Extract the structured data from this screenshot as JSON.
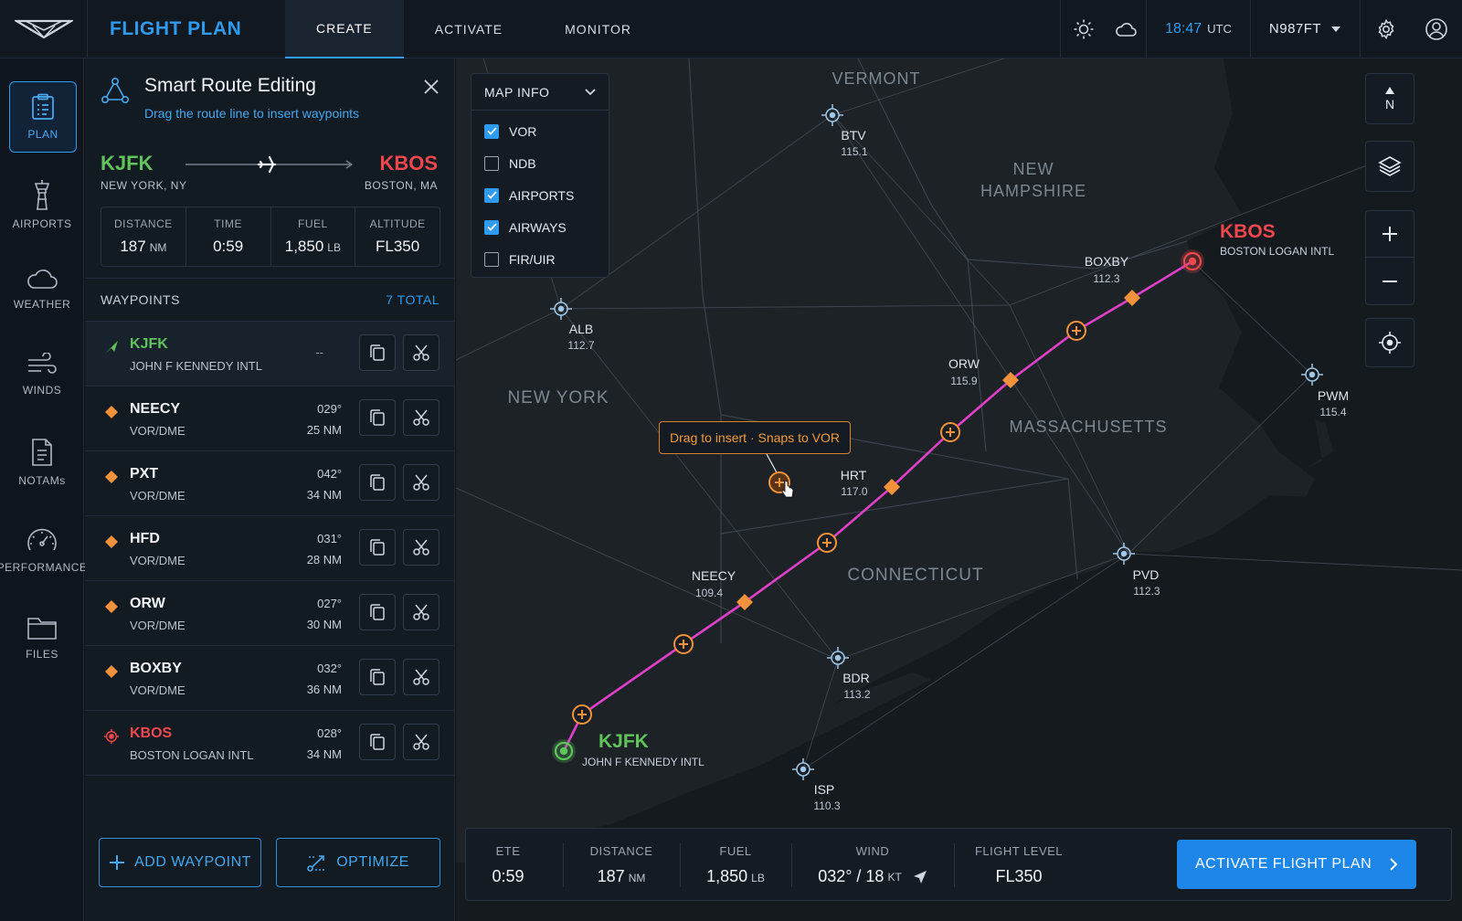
{
  "header": {
    "app_title": "FLIGHT PLAN",
    "tabs": [
      {
        "label": "CREATE",
        "active": true
      },
      {
        "label": "ACTIVATE",
        "active": false
      },
      {
        "label": "MONITOR",
        "active": false
      }
    ],
    "time": "18:47",
    "time_unit": "UTC",
    "tail_number": "N987FT",
    "icons": [
      "sun-icon",
      "cloud-icon",
      "chevron-down-icon",
      "settings-gear-icon",
      "user-profile-icon"
    ]
  },
  "sidenav": {
    "items": [
      {
        "label": "PLAN",
        "icon": "clipboard-icon",
        "active": true
      },
      {
        "label": "AIRPORTS",
        "icon": "control-tower-icon"
      },
      {
        "label": "WEATHER",
        "icon": "cloud-icon"
      },
      {
        "label": "WINDS",
        "icon": "wind-icon"
      },
      {
        "label": "NOTAMs",
        "icon": "document-icon"
      },
      {
        "label": "PERFORMANCE",
        "icon": "gauge-icon"
      },
      {
        "label": "FILES",
        "icon": "folder-icon"
      }
    ]
  },
  "panel": {
    "title": "Smart Route Editing",
    "subtitle": "Drag the route line to insert waypoints",
    "origin": {
      "code": "KJFK",
      "city": "NEW YORK, NY"
    },
    "destination": {
      "code": "KBOS",
      "city": "BOSTON, MA"
    },
    "stats": [
      {
        "label": "DISTANCE",
        "value": "187",
        "unit": "NM"
      },
      {
        "label": "TIME",
        "value": "0:59",
        "unit": ""
      },
      {
        "label": "FUEL",
        "value": "1,850",
        "unit": "LB"
      },
      {
        "label": "ALTITUDE",
        "value": "FL350",
        "unit": ""
      }
    ],
    "waypoints_label": "WAYPOINTS",
    "waypoints_count": "7 TOTAL",
    "waypoints": [
      {
        "name": "KJFK",
        "type": "JOHN F KENNEDY INTL",
        "heading": "",
        "distance": "",
        "dash": "--",
        "kind": "origin"
      },
      {
        "name": "NEECY",
        "type": "VOR/DME",
        "heading": "029°",
        "distance": "25 NM",
        "kind": "vor"
      },
      {
        "name": "PXT",
        "type": "VOR/DME",
        "heading": "042°",
        "distance": "34 NM",
        "kind": "vor"
      },
      {
        "name": "HFD",
        "type": "VOR/DME",
        "heading": "031°",
        "distance": "28 NM",
        "kind": "vor"
      },
      {
        "name": "ORW",
        "type": "VOR/DME",
        "heading": "027°",
        "distance": "30 NM",
        "kind": "vor"
      },
      {
        "name": "BOXBY",
        "type": "VOR/DME",
        "heading": "032°",
        "distance": "36 NM",
        "kind": "vor"
      },
      {
        "name": "KBOS",
        "type": "BOSTON LOGAN INTL",
        "heading": "028°",
        "distance": "34 NM",
        "kind": "destination"
      }
    ],
    "add_waypoint_label": "ADD WAYPOINT",
    "optimize_label": "OPTIMIZE"
  },
  "map": {
    "map_info": {
      "title": "MAP INFO",
      "layers": [
        {
          "label": "VOR",
          "checked": true
        },
        {
          "label": "NDB",
          "checked": false
        },
        {
          "label": "AIRPORTS",
          "checked": true
        },
        {
          "label": "AIRWAYS",
          "checked": true
        },
        {
          "label": "FIR/UIR",
          "checked": false
        }
      ]
    },
    "north_label": "N",
    "states": [
      "VERMONT",
      "NEW",
      "HAMPSHIRE",
      "NEW YORK",
      "MASSACHUSETTS",
      "CONNECTICUT"
    ],
    "navaids": [
      {
        "id": "BTV",
        "freq": "115.1"
      },
      {
        "id": "ALB",
        "freq": "112.7"
      },
      {
        "id": "PWM",
        "freq": "115.4"
      },
      {
        "id": "PVD",
        "freq": "112.3"
      },
      {
        "id": "BDR",
        "freq": "113.2"
      },
      {
        "id": "ISP",
        "freq": "110.3"
      },
      {
        "id": "BOXBY",
        "freq": "112.3"
      },
      {
        "id": "ORW",
        "freq": "115.9"
      },
      {
        "id": "HRT",
        "freq": "117.0"
      },
      {
        "id": "NEECY",
        "freq": "109.4"
      }
    ],
    "airports": [
      {
        "code": "KBOS",
        "name": "BOSTON LOGAN INTL"
      },
      {
        "code": "KJFK",
        "name": "JOHN F KENNEDY INTL"
      }
    ],
    "tooltip": "Drag to insert · Snaps to VOR",
    "route_color": "#e040c8",
    "waypoint_color": "#f2923a"
  },
  "bottombar": {
    "stats": [
      {
        "label": "ETE",
        "value": "0:59",
        "unit": ""
      },
      {
        "label": "DISTANCE",
        "value": "187",
        "unit": "NM"
      },
      {
        "label": "FUEL",
        "value": "1,850",
        "unit": "LB"
      },
      {
        "label": "WIND",
        "value": "032° / 18",
        "unit": "KT"
      },
      {
        "label": "FLIGHT LEVEL",
        "value": "FL350",
        "unit": ""
      }
    ],
    "activate_label": "ACTIVATE FLIGHT PLAN"
  },
  "colors": {
    "accent": "#2e9bf0",
    "origin_green": "#5fc45a",
    "destination_red": "#f0474d",
    "waypoint_orange": "#f2923a",
    "route_magenta": "#e040c8"
  }
}
